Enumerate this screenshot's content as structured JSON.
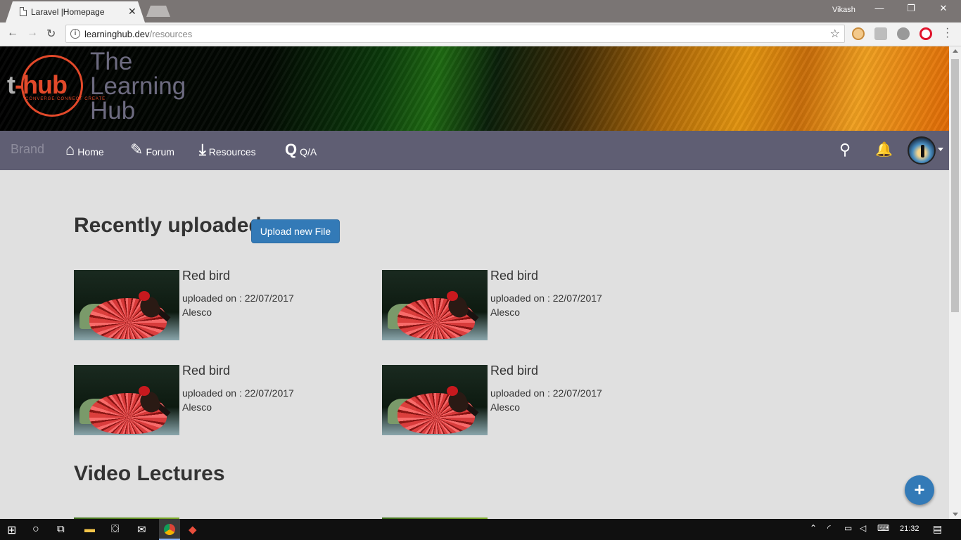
{
  "browser": {
    "tab_title": "Laravel |Homepage",
    "tab_close": "✕",
    "user_name": "Vikash",
    "url_host": "learninghub.dev",
    "url_path": "/resources",
    "info_glyph": "i",
    "star_glyph": "☆",
    "window_minimize": "—",
    "window_restore": "❐",
    "window_close": "✕"
  },
  "banner": {
    "logo_t": "t",
    "logo_hub": "-hub",
    "logo_tagline": "CONVERGE CONNECT CREATE",
    "title_line1": "The",
    "title_line2": "Learning",
    "title_line3": "Hub"
  },
  "navbar": {
    "brand": "Brand",
    "items": [
      {
        "label": "Home",
        "icon": "home-icon",
        "glyph": "⌂"
      },
      {
        "label": "Forum",
        "icon": "edit-icon",
        "glyph": "✎"
      },
      {
        "label": "Resources",
        "icon": "download-icon",
        "glyph": "⤓"
      },
      {
        "label": "Q/A",
        "icon": "q-icon",
        "glyph": "Q"
      }
    ],
    "search_glyph": "⚲",
    "bell_glyph": "🔔"
  },
  "recent": {
    "title": "Recently uploaded",
    "upload_button": "Upload new File",
    "items": [
      {
        "title": "Red bird",
        "uploaded": "uploaded on : 22/07/2017",
        "author": "Alesco"
      },
      {
        "title": "Red bird",
        "uploaded": "uploaded on : 22/07/2017",
        "author": "Alesco"
      },
      {
        "title": "Red bird",
        "uploaded": "uploaded on : 22/07/2017",
        "author": "Alesco"
      },
      {
        "title": "Red bird",
        "uploaded": "uploaded on : 22/07/2017",
        "author": "Alesco"
      }
    ]
  },
  "videos": {
    "title": "Video Lectures"
  },
  "fab": {
    "glyph": "+"
  },
  "taskbar": {
    "time": "21:32"
  },
  "colors": {
    "accent": "#337ab7",
    "navbar": "#5f5e73",
    "logo": "#e2492a"
  }
}
